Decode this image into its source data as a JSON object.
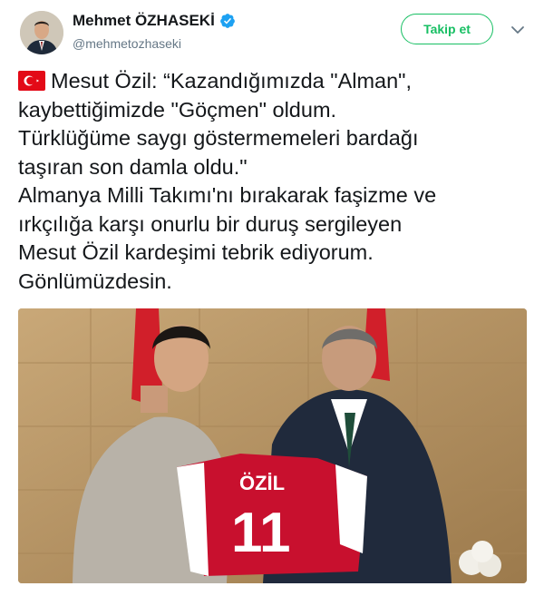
{
  "user": {
    "display_name": "Mehmet ÖZHASEKİ",
    "handle": "@mehmetozhaseki",
    "verified": true
  },
  "follow_button": {
    "label": "Takip et",
    "color": "#17bf63"
  },
  "tweet": {
    "lines": [
      "Mesut Özil: “Kazandığımızda \"Alman\",",
      "kaybettiğimizde \"Göçmen\" oldum.",
      "Türklüğüme saygı göstermemeleri bardağı",
      "taşıran son damla oldu.\"",
      "Almanya Milli Takımı'nı bırakarak faşizme ve",
      "ırkçılığa karşı onurlu bir duruş sergileyen",
      "Mesut Özil kardeşimi tebrik ediyorum.",
      "Gönlümüzdesin."
    ],
    "flag_icon": "turkey-flag-icon"
  },
  "photo": {
    "jersey_name": "ÖZİL",
    "jersey_number": "11"
  },
  "colors": {
    "text": "#14171a",
    "secondary": "#657786",
    "verified_blue": "#1da1f2",
    "flag_red": "#e30a17",
    "jersey_red": "#c8102e"
  }
}
